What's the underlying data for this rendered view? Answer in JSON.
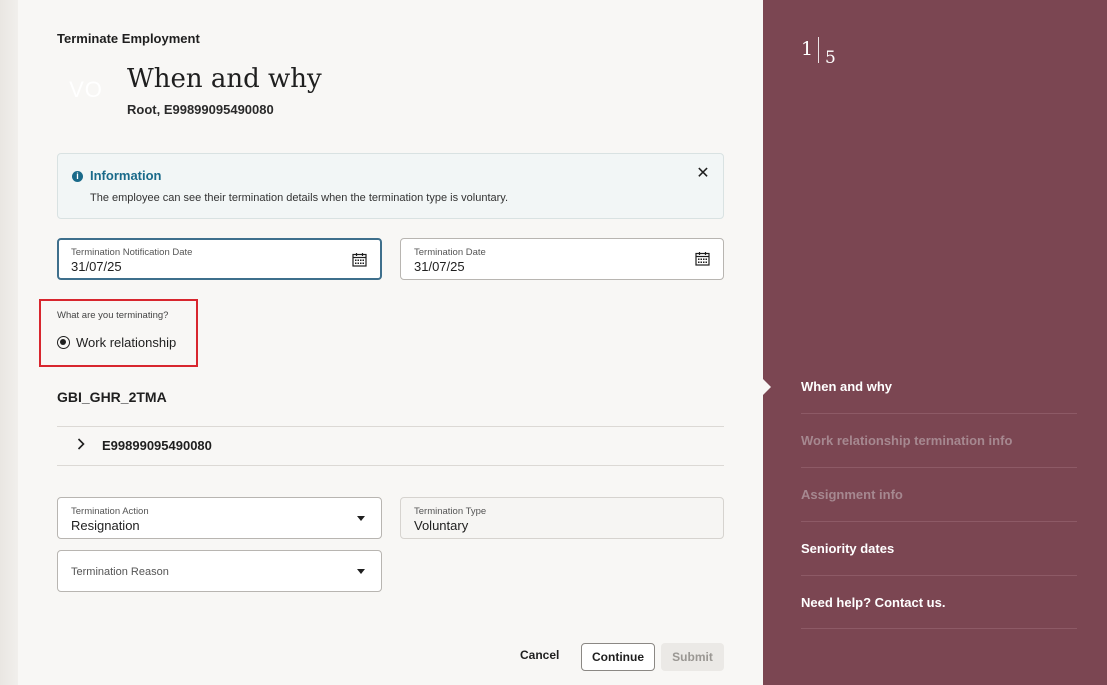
{
  "header": {
    "app_title": "Terminate Employment",
    "avatar_initials": "VO",
    "page_title": "When and why",
    "page_subtitle": "Root, E99899095490080"
  },
  "info_message": {
    "title": "Information",
    "text": "The employee can see their termination details when the termination type is voluntary."
  },
  "dates": {
    "notification_label": "Termination Notification Date",
    "notification_value": "31/07/25",
    "termination_label": "Termination Date",
    "termination_value": "31/07/25"
  },
  "terminating": {
    "question": "What are you terminating?",
    "option": "Work relationship"
  },
  "work_relationship": {
    "title": "GBI_GHR_2TMA",
    "assignment_id": "E99899095490080"
  },
  "action": {
    "action_label": "Termination Action",
    "action_value": "Resignation",
    "type_label": "Termination Type",
    "type_value": "Voluntary",
    "reason_label": "Termination Reason"
  },
  "buttons": {
    "cancel": "Cancel",
    "continue": "Continue",
    "submit": "Submit"
  },
  "progress": {
    "current_step": "1",
    "total_steps": "5"
  },
  "nav": [
    {
      "label": "When and why",
      "state": "current"
    },
    {
      "label": "Work relationship termination info",
      "state": "disabled"
    },
    {
      "label": "Assignment info",
      "state": "disabled"
    },
    {
      "label": "Seniority dates",
      "state": "enabled"
    },
    {
      "label": "Need help? Contact us.",
      "state": "enabled"
    }
  ],
  "colors": {
    "panel": "#7b4652",
    "info_accent": "#1a6a8a",
    "highlight": "#d8262e",
    "focus_border": "#3e6f8c"
  }
}
